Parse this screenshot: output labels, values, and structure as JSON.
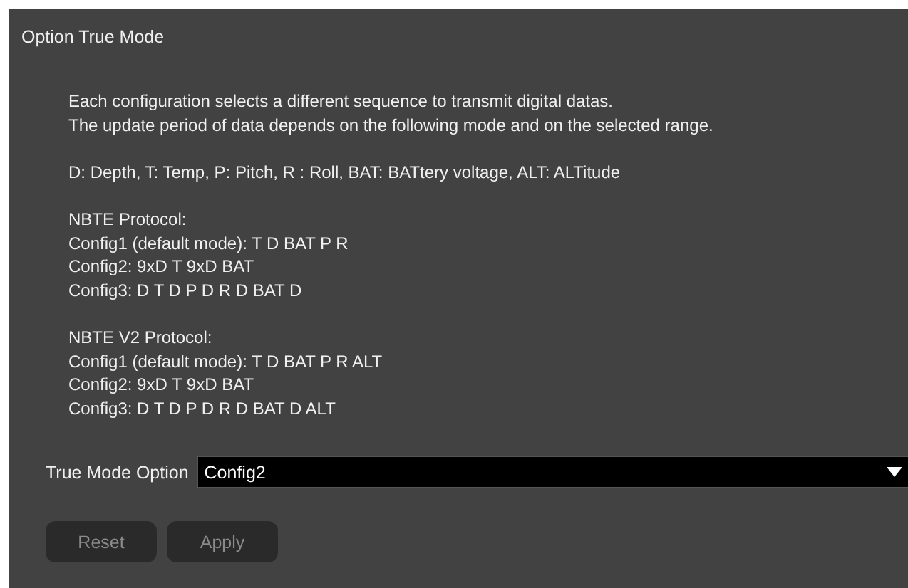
{
  "panel": {
    "title": "Option True Mode"
  },
  "description": [
    "Each configuration selects a different sequence to transmit digital datas.",
    "The update period of data depends on the following mode and on the selected range."
  ],
  "legend": "D: Depth, T: Temp, P: Pitch, R : Roll, BAT: BATtery voltage, ALT: ALTitude",
  "protocols": [
    {
      "title": "NBTE Protocol:",
      "configs": [
        "Config1 (default mode): T D BAT P R",
        "Config2: 9xD T 9xD BAT",
        "Config3: D T D P D R D BAT D"
      ]
    },
    {
      "title": "NBTE V2 Protocol:",
      "configs": [
        "Config1 (default mode): T D BAT P R ALT",
        "Config2: 9xD T 9xD BAT",
        "Config3: D T D P D R D BAT D ALT"
      ]
    }
  ],
  "option": {
    "label": "True Mode Option",
    "value": "Config2"
  },
  "buttons": [
    {
      "label": "Reset",
      "disabled": true
    },
    {
      "label": "Apply",
      "disabled": true
    }
  ]
}
